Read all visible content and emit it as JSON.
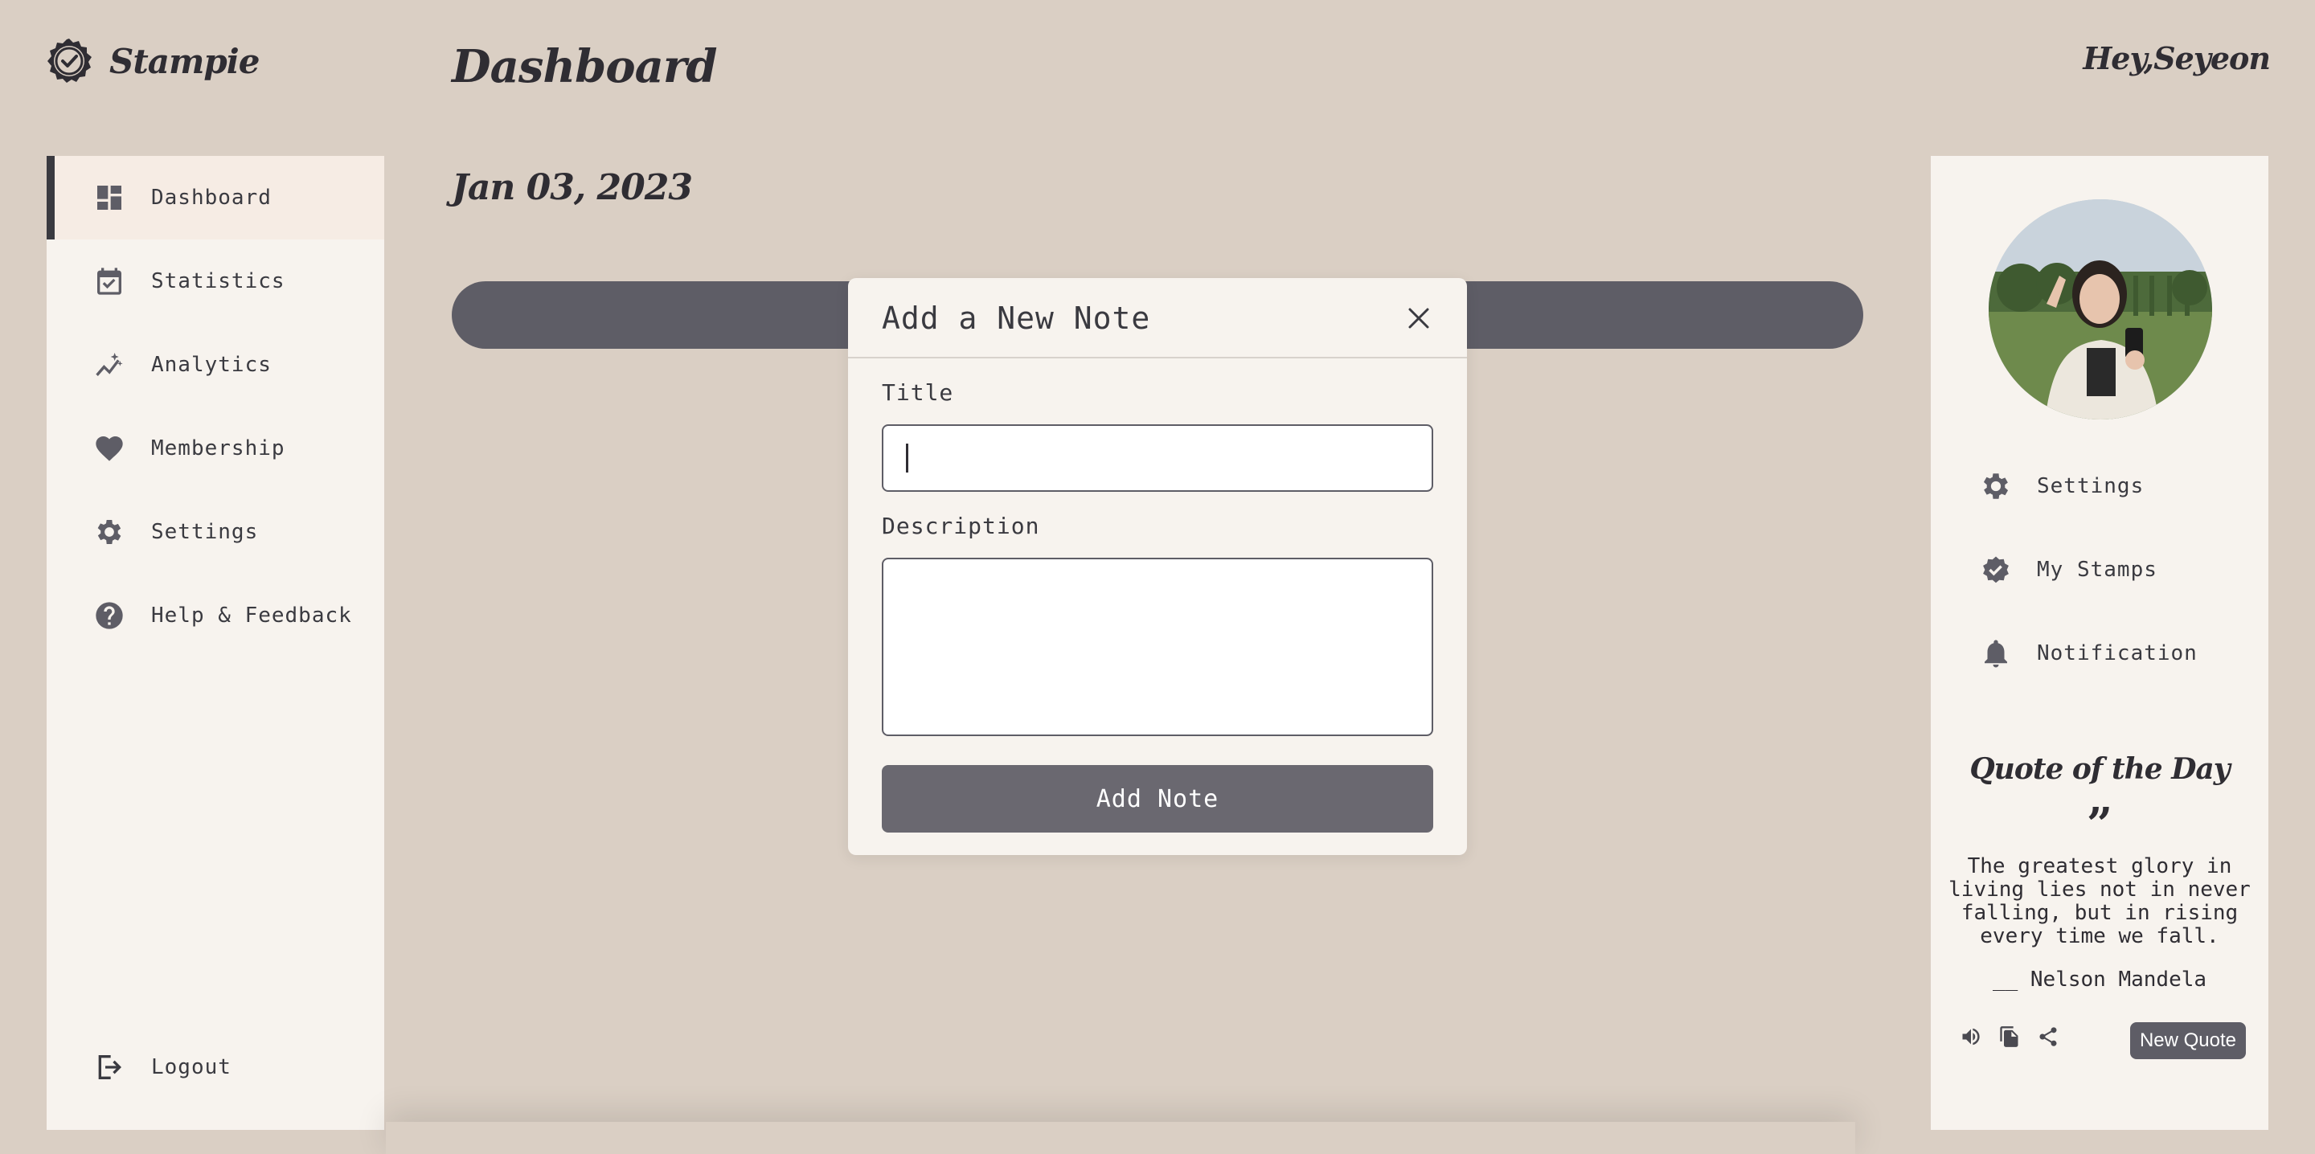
{
  "app": {
    "name": "Stampie",
    "logo_icon": "check-badge-icon"
  },
  "header": {
    "page_title": "Dashboard",
    "greeting": "Hey,Seyeon"
  },
  "sidebar": {
    "items": [
      {
        "label": "Dashboard",
        "icon": "grid-icon",
        "active": true
      },
      {
        "label": "Statistics",
        "icon": "calendar-check-icon"
      },
      {
        "label": "Analytics",
        "icon": "trending-icon"
      },
      {
        "label": "Membership",
        "icon": "heart-icon"
      },
      {
        "label": "Settings",
        "icon": "gear-icon"
      },
      {
        "label": "Help & Feedback",
        "icon": "help-icon"
      }
    ],
    "logout_label": "Logout"
  },
  "main": {
    "date": "Jan 03, 2023"
  },
  "right_panel": {
    "items": [
      {
        "label": "Settings",
        "icon": "gear-icon"
      },
      {
        "label": "My Stamps",
        "icon": "verified-icon"
      },
      {
        "label": "Notification",
        "icon": "bell-icon"
      }
    ],
    "quote": {
      "heading": "Quote of the Day",
      "mark": "”",
      "text": "The greatest glory in living lies not in never falling, but in rising every time we fall.",
      "author": "__ Nelson Mandela",
      "new_quote_label": "New Quote"
    }
  },
  "modal": {
    "title": "Add a New Note",
    "title_label": "Title",
    "title_value": "",
    "description_label": "Description",
    "description_value": "",
    "submit_label": "Add Note"
  },
  "colors": {
    "background": "#dacfc4",
    "panel": "#f7f3ee",
    "accent": "#5e5d66",
    "text": "#3a3a40"
  }
}
